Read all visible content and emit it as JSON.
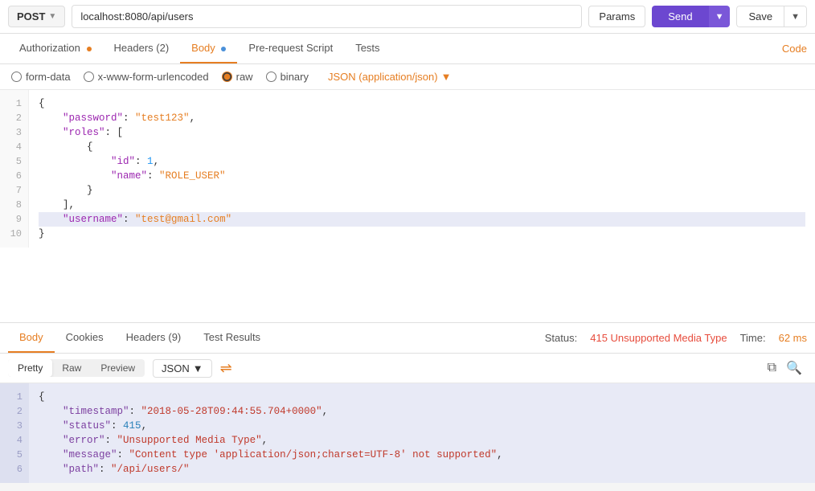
{
  "topbar": {
    "method": "POST",
    "url": "localhost:8080/api/users",
    "params_label": "Params",
    "send_label": "Send",
    "save_label": "Save"
  },
  "req_tabs": [
    {
      "id": "authorization",
      "label": "Authorization",
      "dot": "orange"
    },
    {
      "id": "headers",
      "label": "Headers (2)",
      "dot": null
    },
    {
      "id": "body",
      "label": "Body",
      "dot": "blue",
      "active": true
    },
    {
      "id": "prerequest",
      "label": "Pre-request Script",
      "dot": null
    },
    {
      "id": "tests",
      "label": "Tests",
      "dot": null
    }
  ],
  "code_link": "Code",
  "body_options": {
    "form_data": "form-data",
    "urlencoded": "x-www-form-urlencoded",
    "raw": "raw",
    "binary": "binary",
    "json_format": "JSON (application/json)"
  },
  "request_body": {
    "lines": [
      {
        "num": 1,
        "text": "{",
        "highlight": false
      },
      {
        "num": 2,
        "text": "    \"password\": \"test123\",",
        "highlight": false
      },
      {
        "num": 3,
        "text": "    \"roles\": [",
        "highlight": false
      },
      {
        "num": 4,
        "text": "        {",
        "highlight": false
      },
      {
        "num": 5,
        "text": "            \"id\": 1,",
        "highlight": false
      },
      {
        "num": 6,
        "text": "            \"name\": \"ROLE_USER\"",
        "highlight": false
      },
      {
        "num": 7,
        "text": "        }",
        "highlight": false
      },
      {
        "num": 8,
        "text": "    ],",
        "highlight": false
      },
      {
        "num": 9,
        "text": "    \"username\": \"test@gmail.com\"",
        "highlight": true
      },
      {
        "num": 10,
        "text": "}",
        "highlight": false
      }
    ]
  },
  "resp_tabs": [
    {
      "id": "body",
      "label": "Body",
      "active": true
    },
    {
      "id": "cookies",
      "label": "Cookies"
    },
    {
      "id": "headers",
      "label": "Headers (9)"
    },
    {
      "id": "test_results",
      "label": "Test Results"
    }
  ],
  "status": {
    "label": "Status:",
    "value": "415 Unsupported Media Type",
    "time_label": "Time:",
    "time_value": "62 ms"
  },
  "resp_toolbar": {
    "pretty": "Pretty",
    "raw": "Raw",
    "preview": "Preview",
    "json_format": "JSON"
  },
  "response_body": {
    "lines": [
      {
        "num": 1,
        "text": "{"
      },
      {
        "num": 2,
        "text": "    \"timestamp\": \"2018-05-28T09:44:55.704+0000\","
      },
      {
        "num": 3,
        "text": "    \"status\": 415,"
      },
      {
        "num": 4,
        "text": "    \"error\": \"Unsupported Media Type\","
      },
      {
        "num": 5,
        "text": "    \"message\": \"Content type 'application/json;charset=UTF-8' not supported\","
      },
      {
        "num": 6,
        "text": "    \"path\": \"/api/users/\""
      }
    ]
  }
}
